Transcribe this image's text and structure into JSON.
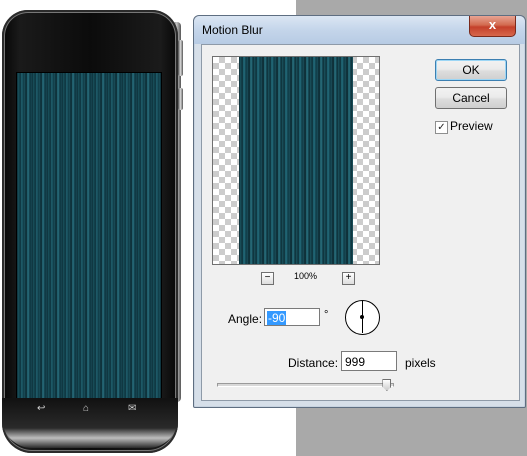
{
  "dialog": {
    "title": "Motion Blur",
    "close_label": "x",
    "ok_label": "OK",
    "cancel_label": "Cancel",
    "preview_label": "Preview",
    "preview_checked": true,
    "zoom": {
      "minus_label": "−",
      "level": "100%",
      "plus_label": "+"
    },
    "angle": {
      "label": "Angle:",
      "value": "-90",
      "unit": "°"
    },
    "distance": {
      "label": "Distance:",
      "value": "999",
      "unit": "pixels",
      "slider_fraction": 0.96
    }
  },
  "phone": {
    "nav_keys": [
      {
        "icon": "back-icon",
        "glyph": "↩"
      },
      {
        "icon": "home-icon",
        "glyph": "⌂"
      },
      {
        "icon": "menu-icon",
        "glyph": "✉"
      }
    ]
  },
  "colors": {
    "title_bar": "#c4d5ea",
    "close_red": "#c4402a",
    "selection": "#3399ff",
    "stripe_teal": "#236776"
  }
}
